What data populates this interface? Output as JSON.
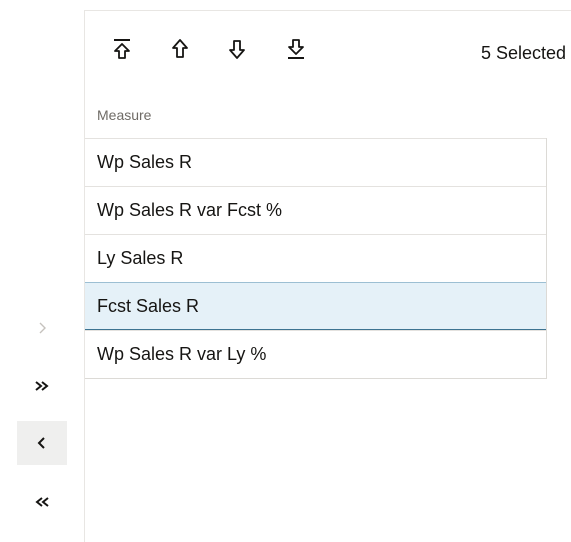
{
  "toolbar": {
    "move_top_icon": "move-to-top-icon",
    "move_up_icon": "move-up-icon",
    "move_down_icon": "move-down-icon",
    "move_bottom_icon": "move-to-bottom-icon",
    "selected_count": "5 Selected"
  },
  "list": {
    "column_header": "Measure",
    "items": [
      {
        "label": "Wp Sales R",
        "selected": false
      },
      {
        "label": "Wp Sales R var Fcst %",
        "selected": false
      },
      {
        "label": "Ly Sales R",
        "selected": false
      },
      {
        "label": "Fcst Sales R",
        "selected": true
      },
      {
        "label": "Wp Sales R var Ly %",
        "selected": false
      }
    ]
  },
  "transfer": {
    "move_right": {
      "icon": "chevron-right-icon",
      "glyph": "›",
      "enabled": false
    },
    "move_all_right": {
      "icon": "double-chevron-right-icon",
      "glyph": "»",
      "enabled": true
    },
    "move_left": {
      "icon": "chevron-left-icon",
      "glyph": "‹",
      "enabled": true
    },
    "move_all_left": {
      "icon": "double-chevron-left-icon",
      "glyph": "«",
      "enabled": true
    }
  },
  "colors": {
    "selected_row_bg": "#e5f1f8",
    "selected_row_border": "#3d7391",
    "disabled_icon": "#c5c2bd",
    "text": "#161513"
  }
}
